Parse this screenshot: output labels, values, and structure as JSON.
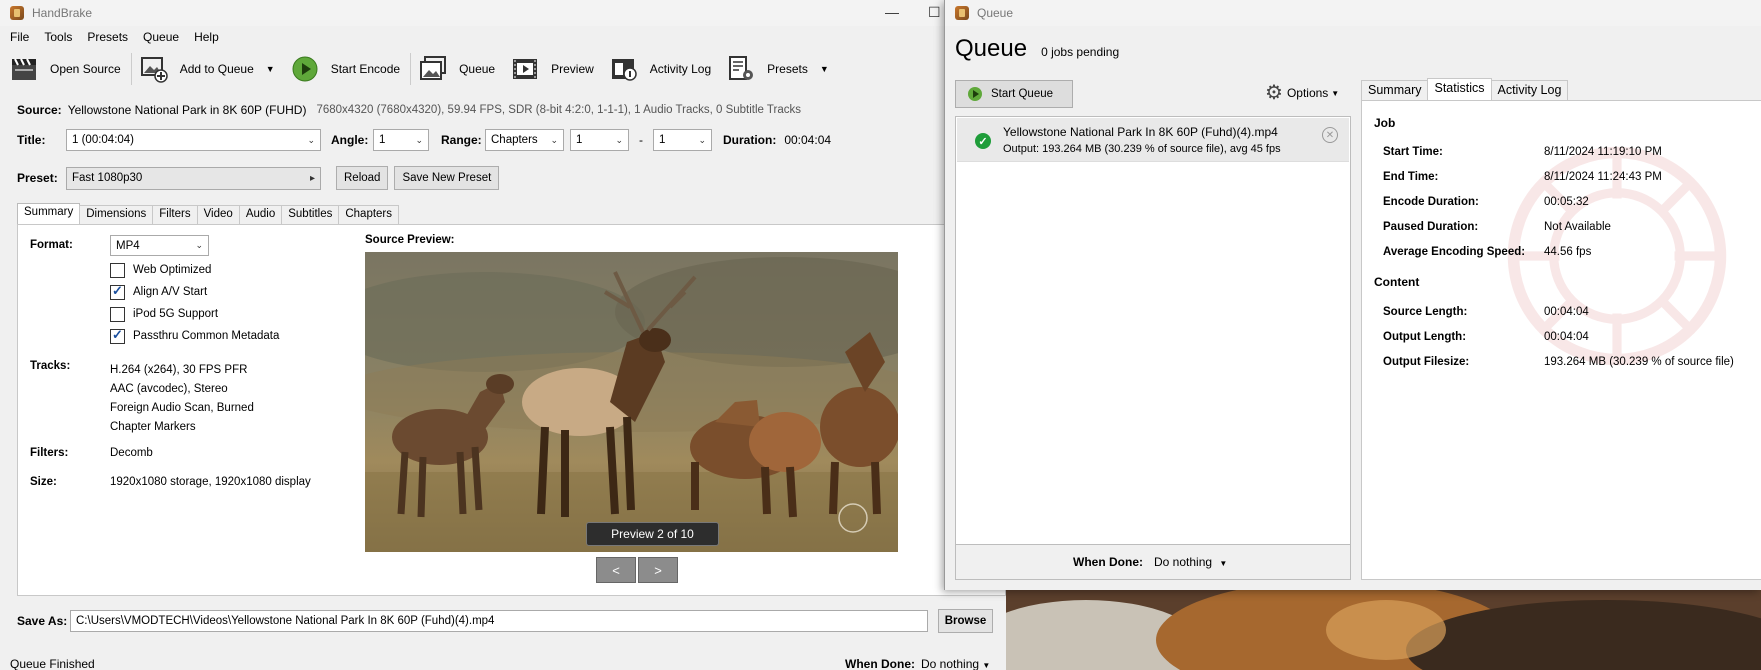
{
  "main": {
    "title": "HandBrake",
    "menu": [
      "File",
      "Tools",
      "Presets",
      "Queue",
      "Help"
    ],
    "toolbar": {
      "open_source": "Open Source",
      "add_to_queue": "Add to Queue",
      "start_encode": "Start Encode",
      "queue": "Queue",
      "preview": "Preview",
      "activity_log": "Activity Log",
      "presets": "Presets"
    },
    "source_label": "Source:",
    "source_name": "Yellowstone National Park in 8K 60P (FUHD)",
    "source_info": "7680x4320 (7680x4320), 59.94 FPS, SDR (8-bit 4:2:0, 1-1-1), 1 Audio Tracks, 0 Subtitle Tracks",
    "title_label": "Title:",
    "title_value": "1 (00:04:04)",
    "angle_label": "Angle:",
    "angle_value": "1",
    "range_label": "Range:",
    "range_type": "Chapters",
    "range_start": "1",
    "range_dash": "-",
    "range_end": "1",
    "duration_label": "Duration:",
    "duration_value": "00:04:04",
    "preset_label": "Preset:",
    "preset_value": "Fast 1080p30",
    "reload": "Reload",
    "save_new_preset": "Save New Preset",
    "tabs": [
      "Summary",
      "Dimensions",
      "Filters",
      "Video",
      "Audio",
      "Subtitles",
      "Chapters"
    ],
    "summary": {
      "format_label": "Format:",
      "format_value": "MP4",
      "options": [
        {
          "label": "Web Optimized",
          "checked": false
        },
        {
          "label": "Align A/V Start",
          "checked": true
        },
        {
          "label": "iPod 5G Support",
          "checked": false
        },
        {
          "label": "Passthru Common Metadata",
          "checked": true
        }
      ],
      "tracks_label": "Tracks:",
      "tracks": [
        "H.264 (x264), 30 FPS PFR",
        "AAC (avcodec), Stereo",
        "Foreign Audio Scan, Burned",
        "Chapter Markers"
      ],
      "filters_label": "Filters:",
      "filters_value": "Decomb",
      "size_label": "Size:",
      "size_value": "1920x1080 storage, 1920x1080 display",
      "source_preview_label": "Source Preview:",
      "preview_badge": "Preview 2 of 10",
      "prev": "<",
      "next": ">"
    },
    "save_as_label": "Save As:",
    "save_as_path": "C:\\Users\\VMODTECH\\Videos\\Yellowstone National Park In 8K 60P (Fuhd)(4).mp4",
    "browse": "Browse",
    "status": "Queue Finished",
    "when_done_label": "When Done:",
    "when_done_value": "Do nothing"
  },
  "queue": {
    "window_title": "Queue",
    "heading": "Queue",
    "jobs_pending": "0 jobs pending",
    "start_queue": "Start Queue",
    "options": "Options",
    "item": {
      "name": "Yellowstone National Park In 8K 60P (Fuhd)(4).mp4",
      "output": "Output: 193.264 MB (30.239 % of source file), avg 45 fps"
    },
    "when_done_label": "When Done:",
    "when_done_value": "Do nothing",
    "tabs": [
      "Summary",
      "Statistics",
      "Activity Log"
    ],
    "stats": {
      "job_title": "Job",
      "start_time_label": "Start Time:",
      "start_time": "8/11/2024 11:19:10 PM",
      "end_time_label": "End Time:",
      "end_time": "8/11/2024 11:24:43 PM",
      "encode_duration_label": "Encode Duration:",
      "encode_duration": "00:05:32",
      "paused_duration_label": "Paused Duration:",
      "paused_duration": "Not Available",
      "avg_speed_label": "Average Encoding Speed:",
      "avg_speed": "44.56 fps",
      "content_title": "Content",
      "source_length_label": "Source Length:",
      "source_length": "00:04:04",
      "output_length_label": "Output Length:",
      "output_length": "00:04:04",
      "output_filesize_label": "Output Filesize:",
      "output_filesize": "193.264 MB (30.239 % of source file)"
    }
  }
}
